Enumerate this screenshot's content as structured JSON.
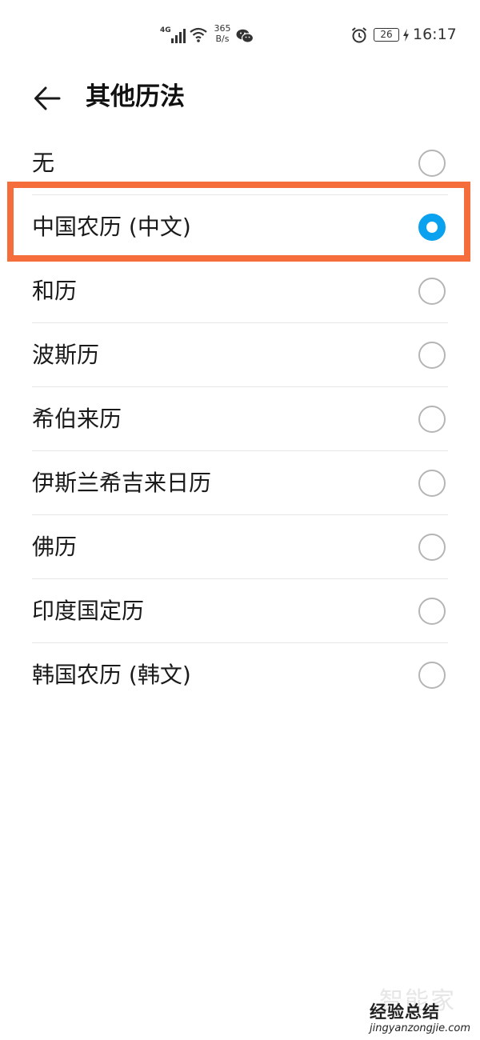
{
  "status_bar": {
    "network": "4G",
    "speed_value": "365",
    "speed_unit": "B/s",
    "battery": "26",
    "time": "16:17",
    "icons": [
      "signal-icon",
      "wifi-icon",
      "wechat-icon",
      "alarm-icon",
      "battery-icon",
      "charging-icon"
    ]
  },
  "header": {
    "back_icon": "arrow-left-icon",
    "title": "其他历法"
  },
  "options": [
    {
      "label": "无",
      "selected": false
    },
    {
      "label": "中国农历 (中文)",
      "selected": true
    },
    {
      "label": "和历",
      "selected": false
    },
    {
      "label": "波斯历",
      "selected": false
    },
    {
      "label": "希伯来历",
      "selected": false
    },
    {
      "label": "伊斯兰希吉来日历",
      "selected": false
    },
    {
      "label": "佛历",
      "selected": false
    },
    {
      "label": "印度国定历",
      "selected": false
    },
    {
      "label": "韩国农历 (韩文)",
      "selected": false
    }
  ],
  "colors": {
    "accent": "#0aa1ee",
    "highlight": "#f56d3b"
  },
  "watermark": {
    "large": "智能家",
    "main": "经验总结",
    "url": "jingyanzongjie.com"
  }
}
